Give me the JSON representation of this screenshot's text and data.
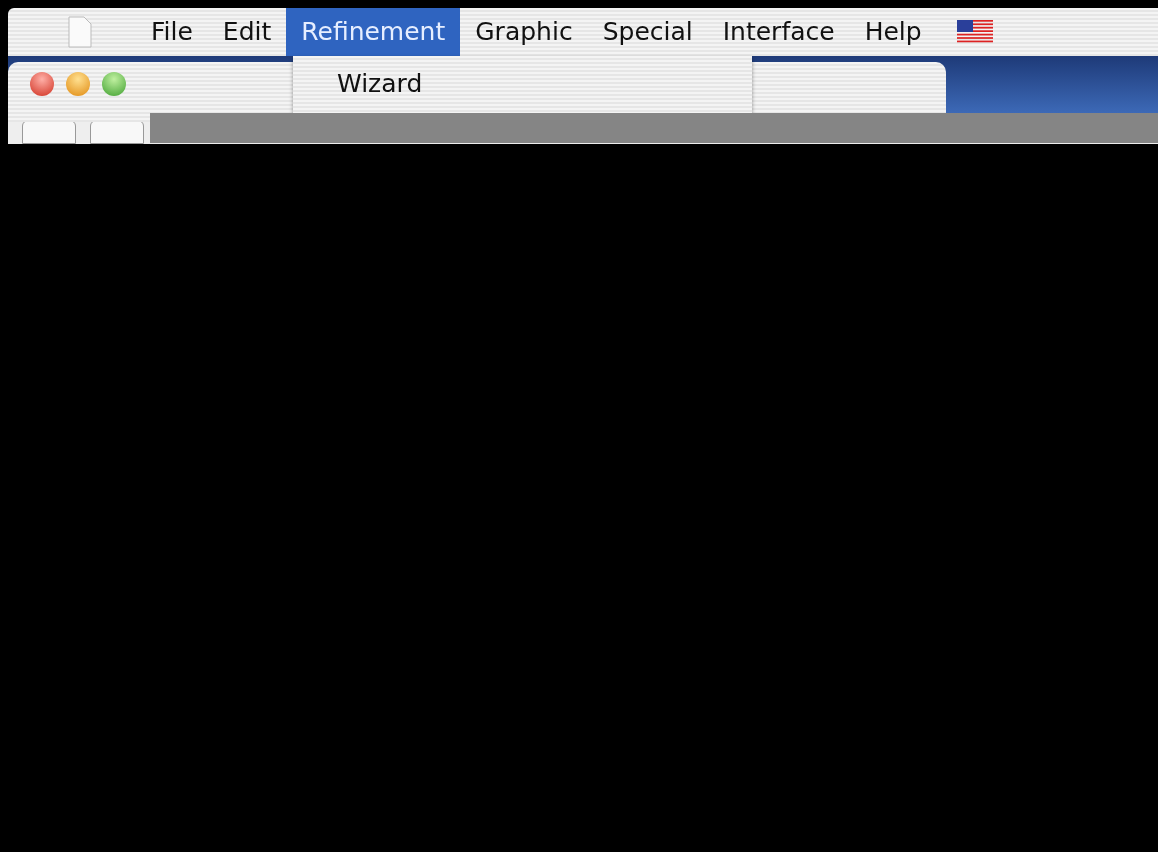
{
  "menu_bar": {
    "items": [
      {
        "label": "File",
        "selected": false
      },
      {
        "label": "Edit",
        "selected": false
      },
      {
        "label": "Refinement",
        "selected": true
      },
      {
        "label": "Graphic",
        "selected": false
      },
      {
        "label": "Special",
        "selected": false
      },
      {
        "label": "Interface",
        "selected": false
      },
      {
        "label": "Help",
        "selected": false
      }
    ]
  },
  "dropdown_menu": {
    "items": [
      {
        "label": "Wizard"
      }
    ]
  }
}
